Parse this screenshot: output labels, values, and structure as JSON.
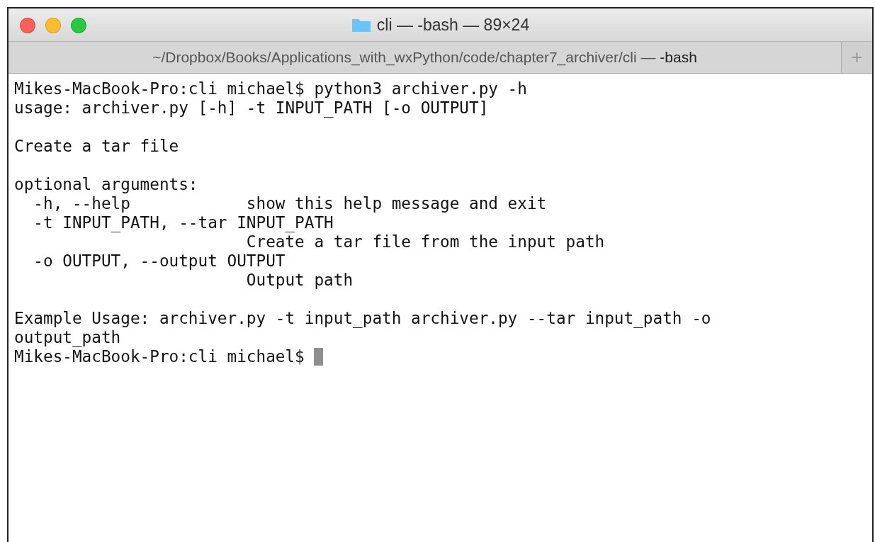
{
  "window": {
    "title": "cli — -bash — 89×24",
    "buttons": [
      {
        "kind": "close"
      },
      {
        "kind": "minimize"
      },
      {
        "kind": "zoom"
      }
    ]
  },
  "tabs": [
    {
      "label": "~/Dropbox/Books/Applications_with_wxPython/code/chapter7_archiver/cli — **-bash**",
      "selected": true
    }
  ],
  "new_tab_button": {
    "label": "+"
  },
  "terminal": {
    "lines": [
      {
        "kind": "text",
        "text": "Mikes-MacBook-Pro:cli michael$ python3 archiver.py -h"
      },
      {
        "kind": "text",
        "text": "usage: archiver.py [-h] -t INPUT_PATH [-o OUTPUT]"
      },
      {
        "kind": "blank"
      },
      {
        "kind": "text",
        "text": "Create a tar file"
      },
      {
        "kind": "blank"
      },
      {
        "kind": "text",
        "text": "optional arguments:"
      },
      {
        "kind": "text",
        "text": "  -h, --help            show this help message and exit"
      },
      {
        "kind": "text",
        "text": "  -t INPUT_PATH, --tar INPUT_PATH"
      },
      {
        "kind": "text",
        "text": "                        Create a tar file from the input path"
      },
      {
        "kind": "text",
        "text": "  -o OUTPUT, --output OUTPUT"
      },
      {
        "kind": "text",
        "text": "                        Output path"
      },
      {
        "kind": "blank"
      },
      {
        "kind": "text",
        "text": "Example Usage: archiver.py -t input_path archiver.py --tar input_path -o"
      },
      {
        "kind": "text",
        "text": "output_path"
      },
      {
        "kind": "prompt",
        "text": "Mikes-MacBook-Pro:cli michael$ ",
        "cursor": true
      }
    ]
  }
}
